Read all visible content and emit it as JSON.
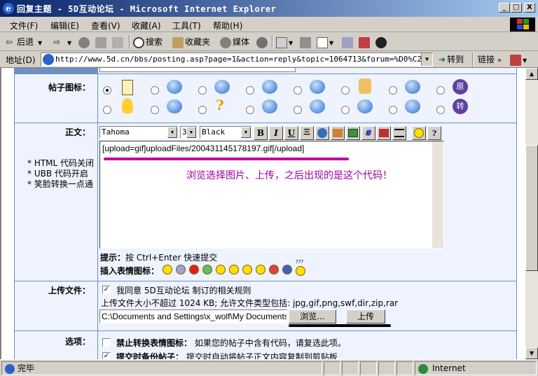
{
  "window": {
    "title": "回复主题 - 5D互动论坛 - Microsoft Internet Explorer",
    "minimize": "_",
    "maximize": "□",
    "close": "X"
  },
  "menu": [
    "文件(F)",
    "编辑(E)",
    "查看(V)",
    "收藏(A)",
    "工具(T)",
    "帮助(H)"
  ],
  "toolbar": {
    "back": "后退",
    "search": "搜索",
    "favorites": "收藏夹",
    "media": "媒体"
  },
  "address": {
    "label": "地址(D)",
    "url": "http://www.5d.cn/bbs/posting.asp?page=1&action=reply&topic=1064713&forum=%D0%C2%CA%D6%C",
    "go": "转到",
    "links": "链接"
  },
  "form": {
    "post_icon_label": "帖子图标：",
    "body_label": "正文：",
    "notes": [
      "* HTML 代码关闭",
      "* UBB  代码开启",
      "* 笑脸转换一点通"
    ],
    "icon_badges": [
      "原",
      "转"
    ],
    "font_family": "Tahoma",
    "font_size": "3",
    "font_color": "Black",
    "format_buttons": [
      "B",
      "I",
      "U",
      "三",
      "#"
    ],
    "textarea_content": "[upload=gif]uploadFiles/200431145178197.gif[/upload]",
    "annotation": "浏览选择图片、上传，之后出现的是这个代码！",
    "tip_label": "提示：",
    "tip_text": "按 Ctrl+Enter 快速提交",
    "emoticon_label": "插入表情图标：",
    "emoticon_extra": "???",
    "upload_label": "上传文件：",
    "agree_text": "我同意 5D互动论坛 制订的相关规则",
    "upload_limit": "上传文件大小不超过 1024 KB; 允许文件类型包括: jpg,gif,png,swf,dir,zip,rar",
    "file_path": "C:\\Documents and Settings\\x_wolf\\My Documents",
    "browse_button": "浏览...",
    "upload_button": "上传",
    "options_label": "选项：",
    "option1_label": "禁止转换表情图标：",
    "option1_desc": "如果您的帖子中含有代码，请复选此项。",
    "option2_label": "提交时备份帖子：",
    "option2_desc": "提交时自动将帖子正文内容复制到剪贴板"
  },
  "status": {
    "text": "完毕",
    "zone": "Internet"
  },
  "colors": {
    "accent_line": "#c000a0",
    "annotation": "#a000a0",
    "form_bg": "#eef3ff",
    "table_border": "#6f8fbf"
  }
}
